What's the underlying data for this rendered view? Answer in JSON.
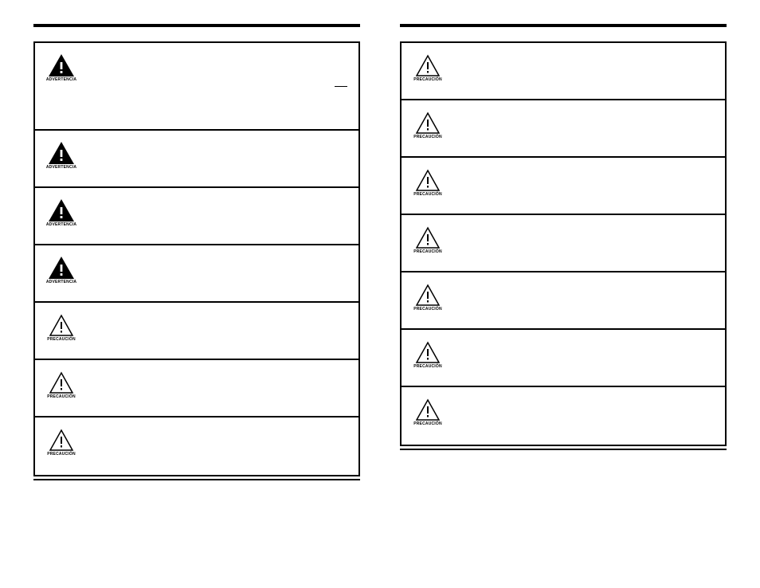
{
  "icons": {
    "advertencia_caption": "ADVERTENCIA",
    "precaucion_caption": "PRECAUCIÓN"
  },
  "left_column": {
    "rows": [
      {
        "type": "advertencia",
        "tall": true
      },
      {
        "type": "advertencia"
      },
      {
        "type": "advertencia"
      },
      {
        "type": "advertencia"
      },
      {
        "type": "precaucion"
      },
      {
        "type": "precaucion"
      },
      {
        "type": "precaucion"
      }
    ]
  },
  "right_column": {
    "rows": [
      {
        "type": "precaucion"
      },
      {
        "type": "precaucion"
      },
      {
        "type": "precaucion"
      },
      {
        "type": "precaucion"
      },
      {
        "type": "precaucion"
      },
      {
        "type": "precaucion"
      },
      {
        "type": "precaucion"
      }
    ]
  }
}
